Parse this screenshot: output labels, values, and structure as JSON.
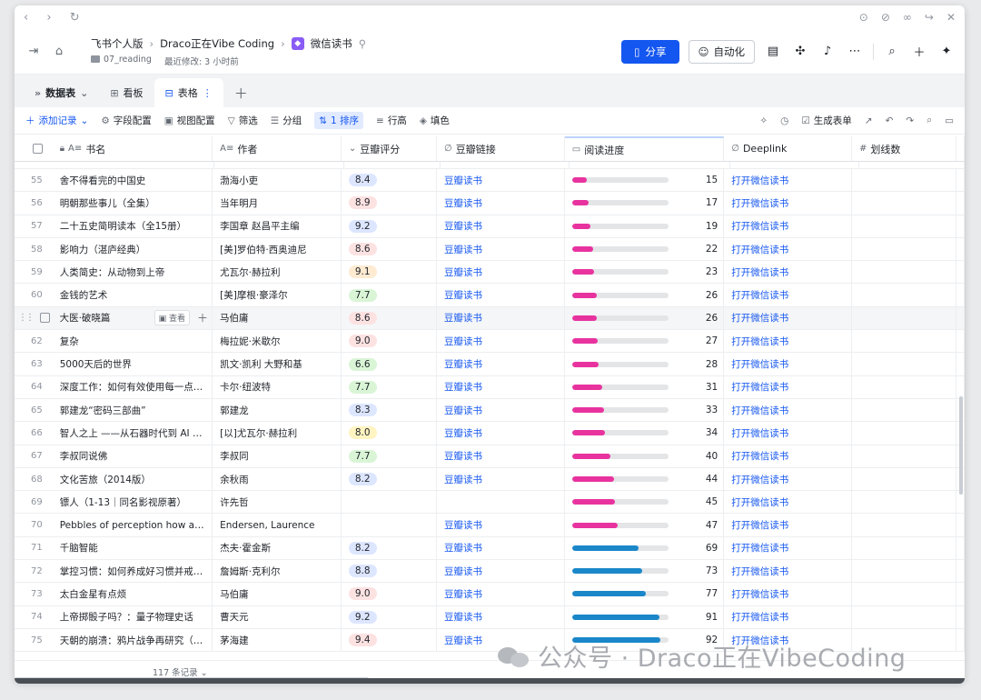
{
  "header": {
    "crumb1": "飞书个人版",
    "crumb2": "Draco正在Vibe Coding",
    "crumb3": "微信读书",
    "folder": "07_reading",
    "modified": "最近修改: 3 小时前",
    "share_label": "分享",
    "automation_label": "自动化"
  },
  "tabs": {
    "datatable": "数据表",
    "board": "看板",
    "table": "表格"
  },
  "toolbar": {
    "add": "添加记录",
    "fields": "字段配置",
    "view": "视图配置",
    "filter": "筛选",
    "group": "分组",
    "sort": "1 排序",
    "rowheight": "行高",
    "fill": "填色",
    "form": "生成表单"
  },
  "columns": {
    "title": "书名",
    "author": "作者",
    "score": "豆瓣评分",
    "link": "豆瓣链接",
    "progress": "阅读进度",
    "deeplink": "Deeplink",
    "marks": "划线数"
  },
  "row_actions": {
    "view": "查看"
  },
  "footer": {
    "count": "117 条记录"
  },
  "watermark": "公众号 · Draco正在VibeCoding",
  "colors": {
    "accent": "#1456f0",
    "progress_low": "#e8339f",
    "progress_high": "#1a87c9"
  },
  "rows": [
    {
      "num": "55",
      "title": "舍不得看完的中国史",
      "author": "渤海小吏",
      "score": "8.4",
      "score_color": "blue",
      "link": "豆瓣读书",
      "progress": 15,
      "deeplink": "打开微信读书"
    },
    {
      "num": "56",
      "title": "明朝那些事儿（全集）",
      "author": "当年明月",
      "score": "8.9",
      "score_color": "red",
      "link": "豆瓣读书",
      "progress": 17,
      "deeplink": "打开微信读书"
    },
    {
      "num": "57",
      "title": "二十五史简明读本（全15册）",
      "author": "李国章 赵昌平主编",
      "score": "9.2",
      "score_color": "blue",
      "link": "豆瓣读书",
      "progress": 19,
      "deeplink": "打开微信读书"
    },
    {
      "num": "58",
      "title": "影响力（湛庐经典）",
      "author": "[美]罗伯特·西奥迪尼",
      "score": "8.6",
      "score_color": "red",
      "link": "豆瓣读书",
      "progress": 22,
      "deeplink": "打开微信读书"
    },
    {
      "num": "59",
      "title": "人类简史：从动物到上帝",
      "author": "尤瓦尔·赫拉利",
      "score": "9.1",
      "score_color": "orange",
      "link": "豆瓣读书",
      "progress": 23,
      "deeplink": "打开微信读书"
    },
    {
      "num": "60",
      "title": "金钱的艺术",
      "author": "[美]摩根·豪泽尔",
      "score": "7.7",
      "score_color": "green",
      "link": "豆瓣读书",
      "progress": 26,
      "deeplink": "打开微信读书"
    },
    {
      "num": "",
      "title": "大医·破晓篇",
      "author": "马伯庸",
      "score": "8.6",
      "score_color": "red",
      "link": "豆瓣读书",
      "progress": 26,
      "deeplink": "打开微信读书",
      "hover": true
    },
    {
      "num": "62",
      "title": "复杂",
      "author": "梅拉妮·米歇尔",
      "score": "9.0",
      "score_color": "red",
      "link": "豆瓣读书",
      "progress": 27,
      "deeplink": "打开微信读书"
    },
    {
      "num": "63",
      "title": "5000天后的世界",
      "author": "凯文·凯利 大野和基",
      "score": "6.6",
      "score_color": "green",
      "link": "豆瓣读书",
      "progress": 28,
      "deeplink": "打开微信读书"
    },
    {
      "num": "64",
      "title": "深度工作：如何有效使用每一点脑力",
      "author": "卡尔·纽波特",
      "score": "7.7",
      "score_color": "green",
      "link": "豆瓣读书",
      "progress": 31,
      "deeplink": "打开微信读书"
    },
    {
      "num": "65",
      "title": "郭建龙“密码三部曲”",
      "author": "郭建龙",
      "score": "8.3",
      "score_color": "blue",
      "link": "豆瓣读书",
      "progress": 33,
      "deeplink": "打开微信读书"
    },
    {
      "num": "66",
      "title": "智人之上 ——从石器时代到 AI 时代的信息网络简史",
      "author": "[以]尤瓦尔·赫拉利",
      "score": "8.0",
      "score_color": "yellow",
      "link": "豆瓣读书",
      "progress": 34,
      "deeplink": "打开微信读书"
    },
    {
      "num": "67",
      "title": "李叔同说佛",
      "author": "李叔同",
      "score": "7.7",
      "score_color": "green",
      "link": "豆瓣读书",
      "progress": 40,
      "deeplink": "打开微信读书"
    },
    {
      "num": "68",
      "title": "文化苦旅（2014版）",
      "author": "余秋雨",
      "score": "8.2",
      "score_color": "blue",
      "link": "豆瓣读书",
      "progress": 44,
      "deeplink": "打开微信读书"
    },
    {
      "num": "69",
      "title": "镖人（1-13｜同名影视原著）",
      "author": "许先哲",
      "score": "",
      "score_color": "",
      "link": "",
      "progress": 45,
      "deeplink": "打开微信读书"
    },
    {
      "num": "70",
      "title": "Pebbles of perception how a few good choices make all the difference",
      "author": "Endersen, Laurence",
      "score": "",
      "score_color": "",
      "link": "豆瓣读书",
      "progress": 47,
      "deeplink": "打开微信读书"
    },
    {
      "num": "71",
      "title": "千脑智能",
      "author": "杰夫·霍金斯",
      "score": "8.2",
      "score_color": "blue",
      "link": "豆瓣读书",
      "progress": 69,
      "deeplink": "打开微信读书"
    },
    {
      "num": "72",
      "title": "掌控习惯：如何养成好习惯并戒除坏习惯",
      "author": "詹姆斯·克利尔",
      "score": "8.8",
      "score_color": "blue",
      "link": "豆瓣读书",
      "progress": 73,
      "deeplink": "打开微信读书"
    },
    {
      "num": "73",
      "title": "太白金星有点烦",
      "author": "马伯庸",
      "score": "9.0",
      "score_color": "red",
      "link": "豆瓣读书",
      "progress": 77,
      "deeplink": "打开微信读书"
    },
    {
      "num": "74",
      "title": "上帝掷骰子吗？：量子物理史话",
      "author": "曹天元",
      "score": "9.2",
      "score_color": "blue",
      "link": "豆瓣读书",
      "progress": 91,
      "deeplink": "打开微信读书"
    },
    {
      "num": "75",
      "title": "天朝的崩溃：鸦片战争再研究（修订版）",
      "author": "茅海建",
      "score": "9.4",
      "score_color": "red",
      "link": "豆瓣读书",
      "progress": 92,
      "deeplink": "打开微信读书"
    }
  ]
}
